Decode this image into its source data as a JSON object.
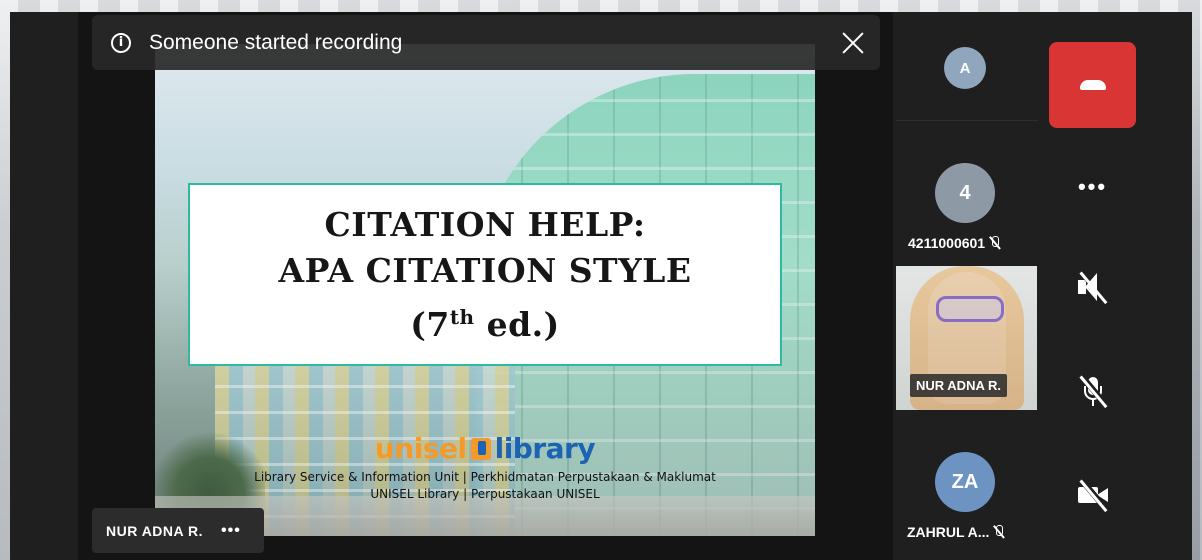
{
  "notification": {
    "message": "Someone started recording",
    "info_icon": "info-icon",
    "close_icon": "close-icon"
  },
  "slide": {
    "title_line1": "CITATION HELP:",
    "title_line2": "APA CITATION STYLE",
    "title_line3_prefix": "(7",
    "title_line3_sup": "th",
    "title_line3_suffix": " ed.)",
    "logo_unisel": "unisel",
    "logo_library": "library",
    "caption_line1": "Library Service & Information Unit | Perkhidmatan Perpustakaan & Maklumat",
    "caption_line2": "UNISEL Library | Perpustakaan UNISEL",
    "accent_color": "#2fb9a2"
  },
  "presenter": {
    "name": "NUR ADNA R.",
    "more_label": "•••"
  },
  "participants": [
    {
      "initials": "A",
      "color": "#90a6bd"
    },
    {
      "initials": "4",
      "label": "4211000601",
      "muted": true,
      "color": "#8d9aa5"
    },
    {
      "label": "NUR ADNA R.",
      "video": true
    },
    {
      "initials": "ZA",
      "label": "ZAHRUL A...",
      "muted": true,
      "color": "#6d93c2"
    }
  ],
  "controls": {
    "end_call_color": "#d93535",
    "more_label": "•••",
    "speaker_state": "off",
    "mic_state": "off",
    "camera_state": "off"
  }
}
